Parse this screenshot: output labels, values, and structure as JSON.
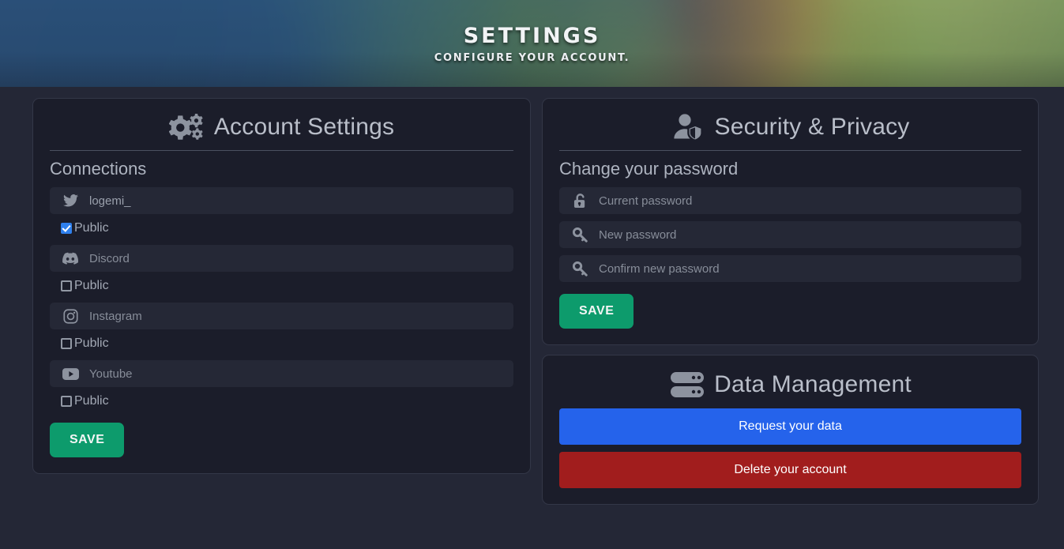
{
  "banner": {
    "title": "SETTINGS",
    "subtitle": "CONFIGURE YOUR ACCOUNT."
  },
  "account": {
    "heading": "Account Settings",
    "heading_icon": "gears-icon",
    "section_label": "Connections",
    "connections": [
      {
        "icon": "twitter-icon",
        "name": "twitter",
        "value": "logemi_",
        "placeholder": "Twitter",
        "public_label": "Public",
        "public": true
      },
      {
        "icon": "discord-icon",
        "name": "discord",
        "value": "",
        "placeholder": "Discord",
        "public_label": "Public",
        "public": false
      },
      {
        "icon": "instagram-icon",
        "name": "instagram",
        "value": "",
        "placeholder": "Instagram",
        "public_label": "Public",
        "public": false
      },
      {
        "icon": "youtube-icon",
        "name": "youtube",
        "value": "",
        "placeholder": "Youtube",
        "public_label": "Public",
        "public": false
      }
    ],
    "save_label": "SAVE"
  },
  "security": {
    "heading": "Security & Privacy",
    "heading_icon": "user-shield-icon",
    "section_label": "Change your password",
    "fields": [
      {
        "icon": "unlock-icon",
        "placeholder": "Current password",
        "value": ""
      },
      {
        "icon": "key-icon",
        "placeholder": "New password",
        "value": ""
      },
      {
        "icon": "key-icon",
        "placeholder": "Confirm new password",
        "value": ""
      }
    ],
    "save_label": "SAVE"
  },
  "data_management": {
    "heading": "Data Management",
    "heading_icon": "server-icon",
    "request_label": "Request your data",
    "delete_label": "Delete your account"
  },
  "colors": {
    "page_bg": "#242736",
    "panel_bg": "#1b1d2a",
    "input_bg": "#252836",
    "save_green": "#0d9b6c",
    "request_blue": "#2563eb",
    "delete_red": "#a11d1d",
    "checkbox_blue": "#2f80ed"
  }
}
